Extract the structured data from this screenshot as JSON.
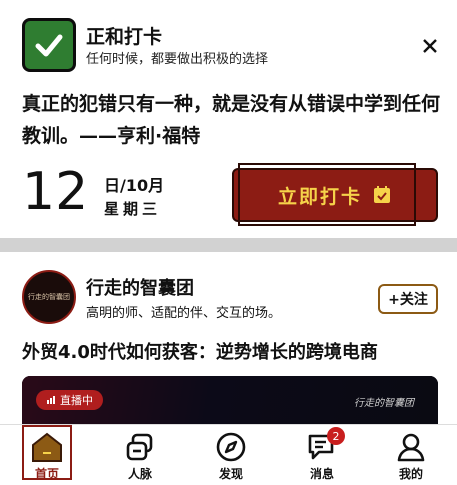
{
  "checkin": {
    "app_title": "正和打卡",
    "app_subtitle": "任何时候，都要做出积极的选择",
    "quote": "真正的犯错只有一种，就是没有从错误中学到任何教训。——亨利·福特",
    "day": "12",
    "date_month": "日/10月",
    "weekday": "星期三",
    "button_label": "立即打卡"
  },
  "group": {
    "avatar_text": "行走的智囊团",
    "name": "行走的智囊团",
    "description": "高明的师、适配的伴、交互的场。",
    "follow_label": "+关注",
    "article_title": "外贸4.0时代如何获客：逆势增长的跨境电商",
    "live_label": "直播中",
    "video_brand": "行走的智囊团"
  },
  "nav": {
    "items": [
      {
        "label": "首页"
      },
      {
        "label": "人脉"
      },
      {
        "label": "发现"
      },
      {
        "label": "消息",
        "badge": "2"
      },
      {
        "label": "我的"
      }
    ]
  },
  "colors": {
    "brand_red": "#8c1c14",
    "button_text": "#f6d34a",
    "check_green": "#2f7d31"
  }
}
